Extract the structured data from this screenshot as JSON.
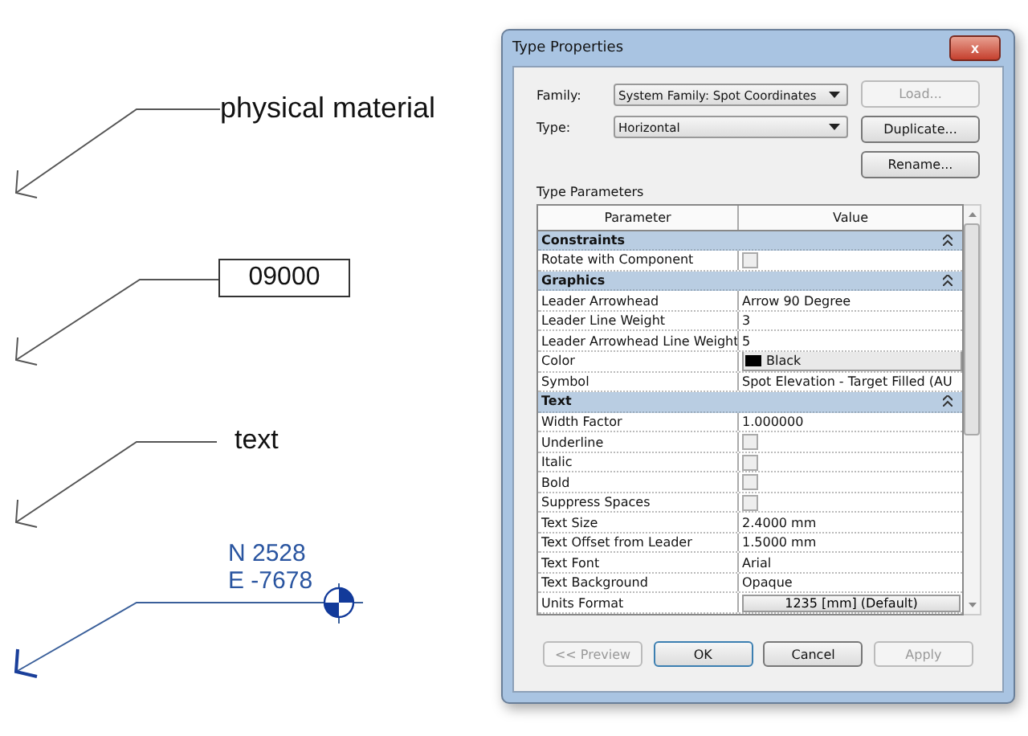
{
  "annotations": [
    {
      "kind": "plain",
      "text": "physical material"
    },
    {
      "kind": "boxed",
      "text": "09000"
    },
    {
      "kind": "plain",
      "text": "text"
    },
    {
      "kind": "coordinates",
      "lines": [
        "N 2528",
        "E -7678"
      ]
    }
  ],
  "dialog": {
    "title": "Type Properties",
    "close": "x",
    "family": {
      "label": "Family:",
      "value": "System Family: Spot Coordinates"
    },
    "type": {
      "label": "Type:",
      "value": "Horizontal"
    },
    "side_buttons": [
      {
        "label": "Load...",
        "disabled": true
      },
      {
        "label": "Duplicate...",
        "disabled": false
      },
      {
        "label": "Rename...",
        "disabled": false
      }
    ],
    "section_label": "Type Parameters",
    "columns": [
      "Parameter",
      "Value"
    ],
    "rows": [
      {
        "kind": "section",
        "name": "Constraints"
      },
      {
        "kind": "checkbox",
        "name": "Rotate with Component",
        "checked": false
      },
      {
        "kind": "section",
        "name": "Graphics"
      },
      {
        "kind": "text",
        "name": "Leader Arrowhead",
        "value": "Arrow 90 Degree"
      },
      {
        "kind": "text",
        "name": "Leader Line Weight",
        "value": "3"
      },
      {
        "kind": "text",
        "name": "Leader Arrowhead Line Weight",
        "value": "5"
      },
      {
        "kind": "color",
        "name": "Color",
        "value": "Black",
        "color": "#000000"
      },
      {
        "kind": "text",
        "name": "Symbol",
        "value": "Spot Elevation - Target Filled (AU"
      },
      {
        "kind": "section",
        "name": "Text"
      },
      {
        "kind": "text",
        "name": "Width Factor",
        "value": "1.000000"
      },
      {
        "kind": "checkbox",
        "name": "Underline",
        "checked": false
      },
      {
        "kind": "checkbox",
        "name": "Italic",
        "checked": false
      },
      {
        "kind": "checkbox",
        "name": "Bold",
        "checked": false
      },
      {
        "kind": "checkbox",
        "name": "Suppress Spaces",
        "checked": false
      },
      {
        "kind": "text",
        "name": "Text Size",
        "value": "2.4000 mm"
      },
      {
        "kind": "text",
        "name": "Text Offset from Leader",
        "value": "1.5000 mm"
      },
      {
        "kind": "text",
        "name": "Text Font",
        "value": "Arial"
      },
      {
        "kind": "text",
        "name": "Text Background",
        "value": "Opaque"
      },
      {
        "kind": "button",
        "name": "Units Format",
        "value": "1235 [mm] (Default)"
      }
    ],
    "buttons": [
      {
        "label": "<< Preview",
        "disabled": true
      },
      {
        "label": "OK",
        "disabled": false
      },
      {
        "label": "Cancel",
        "disabled": false
      },
      {
        "label": "Apply",
        "disabled": true
      }
    ]
  }
}
